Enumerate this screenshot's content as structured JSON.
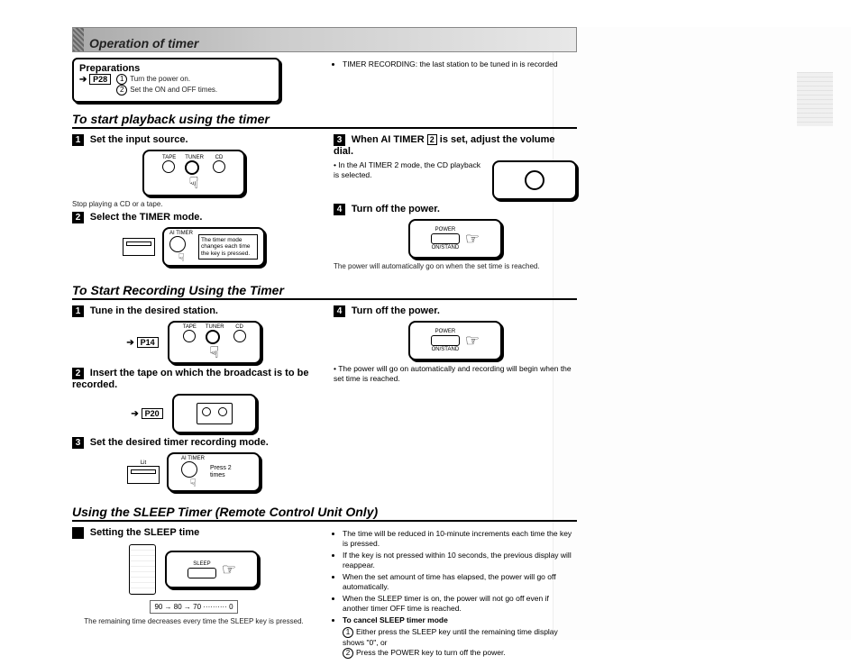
{
  "header": {
    "title": "Operation of timer"
  },
  "preparations": {
    "title": "Preparations",
    "page_ref": "P28",
    "items": [
      "Turn the power on.",
      "Set the ON and OFF times."
    ]
  },
  "top_right_note": "TIMER RECORDING: the last station to be tuned in is recorded",
  "playback": {
    "heading": "To start playback using the timer",
    "step1": {
      "title": "Set the input source.",
      "note": "Stop playing a CD or a tape.",
      "labels": [
        "TAPE",
        "TUNER",
        "CD"
      ]
    },
    "step2": {
      "title": "Select the TIMER mode.",
      "btn_label": "AI TIMER",
      "note_box": "The timer mode changes each time the key is pressed."
    },
    "step3": {
      "title_pre": "When AI TIMER ",
      "title_badge": "2",
      "title_post": " is set, adjust the volume dial.",
      "note": "In the AI TIMER 2 mode, the CD playback is selected."
    },
    "step4": {
      "title": "Turn off the power.",
      "btn_label": "POWER",
      "sub_label": "ON/STAND",
      "footer": "The power will automatically go on when the set time is reached."
    }
  },
  "recording": {
    "heading": "To Start Recording Using the Timer",
    "step1": {
      "title": "Tune in the desired station.",
      "page_ref": "P14",
      "labels": [
        "TAPE",
        "TUNER",
        "CD"
      ]
    },
    "step2": {
      "title": "Insert the tape on which the broadcast is to be recorded.",
      "page_ref": "P20"
    },
    "step3": {
      "title": "Set the desired timer recording mode.",
      "btn_label": "AI TIMER",
      "note_box": "Press 2 times",
      "side_label": "Lit"
    },
    "step4": {
      "title": "Turn off the power.",
      "btn_label": "POWER",
      "sub_label": "ON/STAND",
      "footer": "The power will go on automatically and recording will begin when the set time is reached."
    }
  },
  "sleep": {
    "heading": "Using the SLEEP Timer (Remote Control Unit Only)",
    "step_title": "Setting the SLEEP time",
    "btn_label": "SLEEP",
    "sequence": "90 → 80 → 70 ·········· 0",
    "seq_note": "The remaining time decreases every time the SLEEP key is pressed.",
    "bullets": [
      "The time will be reduced in 10-minute increments each time the key is pressed.",
      "If the key is not pressed within 10 seconds, the previous display will reappear.",
      "When the set amount of time has elapsed, the power will go off automatically.",
      "When the SLEEP timer is on, the power will not go off even if another timer OFF time is reached."
    ],
    "cancel_title": "To cancel SLEEP timer mode",
    "cancel_steps": [
      "Either press the SLEEP key until the remaining time display shows \"0\", or",
      "Press the POWER key to turn off the power."
    ]
  }
}
